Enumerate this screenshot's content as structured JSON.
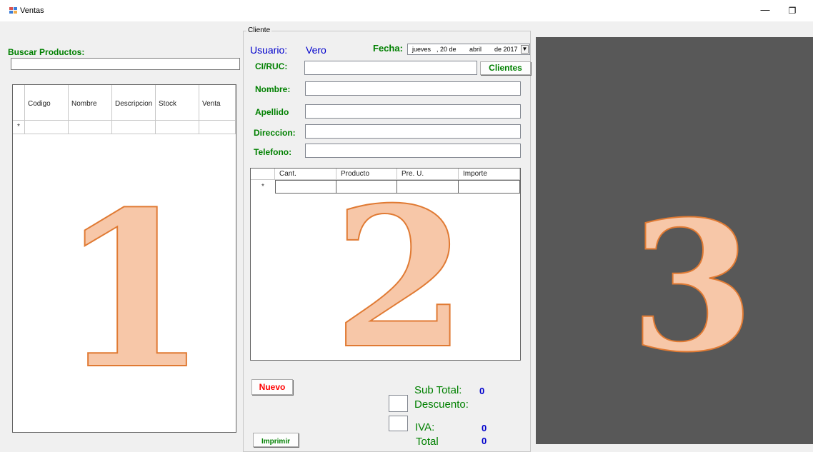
{
  "window": {
    "title": "Ventas",
    "min_glyph": "—",
    "max_glyph": "❐"
  },
  "search": {
    "label": "Buscar Productos:",
    "value": ""
  },
  "products_grid": {
    "columns": [
      "Codigo",
      "Nombre",
      "Descripcion",
      "Stock",
      "Venta"
    ],
    "new_row_marker": "*"
  },
  "cliente": {
    "group_label": "Cliente",
    "usuario_label": "Usuario:",
    "usuario_value": "Vero",
    "fecha_label": "Fecha:",
    "fecha_day": "jueves",
    "fecha_mid": ", 20 de",
    "fecha_month": "abril",
    "fecha_year": "de 2017",
    "ci_label": "CI/RUC:",
    "clientes_button": "Clientes",
    "nombre_label": "Nombre:",
    "apellido_label": "Apellido",
    "direccion_label": "Direccion:",
    "telefono_label": "Telefono:"
  },
  "detail_grid": {
    "columns": [
      "Cant.",
      "Producto",
      "Pre. U.",
      "Importe"
    ],
    "new_row_marker": "*"
  },
  "buttons": {
    "nuevo": "Nuevo",
    "imprimir": "Imprimir"
  },
  "totals": {
    "subtotal_label": "Sub Total:",
    "subtotal_value": "0",
    "descuento_label": "Descuento:",
    "iva_label": "IVA:",
    "iva_value": "0",
    "total_label": "Total",
    "total_value": "0"
  },
  "annotations": {
    "one": "1",
    "two": "2",
    "three": "3"
  },
  "colors": {
    "label_green": "#008000",
    "value_blue": "#0000cc",
    "nuevo_red": "#ff0000",
    "dark_panel": "#585858",
    "number_fill": "#f7c7a8",
    "number_stroke": "#e07a33"
  }
}
